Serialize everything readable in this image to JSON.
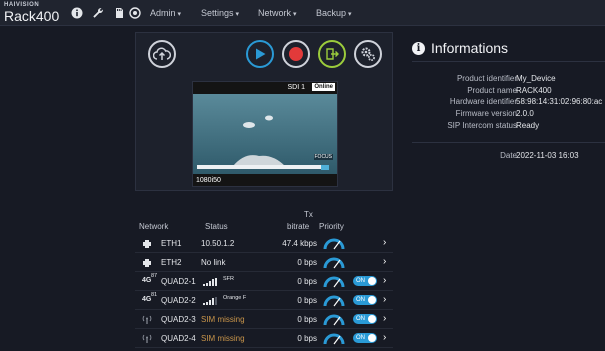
{
  "brand": {
    "company": "HAIVISION",
    "product": "Rack400"
  },
  "topbar": {
    "icons": [
      "info-icon",
      "wrench-icon",
      "sd-card-icon",
      "settings-circle-icon"
    ],
    "menus": [
      "Admin",
      "Settings",
      "Network",
      "Backup"
    ]
  },
  "controls": [
    "cloud-upload-icon",
    "play-icon",
    "record-icon",
    "export-icon",
    "gears-icon"
  ],
  "preview": {
    "input": "SDI 1",
    "status": "Online",
    "timecode": "1080i50",
    "watermark": "FOCUS"
  },
  "info": {
    "title": "Informations",
    "rows": [
      {
        "key": "Product identifier",
        "value": "My_Device"
      },
      {
        "key": "Product name",
        "value": "RACK400"
      },
      {
        "key": "Hardware identifier",
        "value": "58:98:14:31:02:96:80:ac"
      },
      {
        "key": "Firmware version",
        "value": "2.0.0"
      },
      {
        "key": "SIP Intercom status",
        "value": "Ready"
      }
    ],
    "date": {
      "key": "Date",
      "value": "2022-11-03 16:03"
    }
  },
  "network": {
    "headers": {
      "network": "Network",
      "status": "Status",
      "tx1": "Tx",
      "tx2": "bitrate",
      "priority": "Priority"
    },
    "rows": [
      {
        "name": "ETH1",
        "status": "10.50.1.2",
        "bitrate": "47.4 kbps",
        "type": "ethernet",
        "toggle": ""
      },
      {
        "name": "ETH2",
        "status": "No link",
        "bitrate": "0 bps",
        "type": "ethernet",
        "toggle": ""
      },
      {
        "name": "QUAD2-1",
        "status": "",
        "carrier": "SFR",
        "signal": "87",
        "bitrate": "0 bps",
        "type": "4g",
        "toggle": "ON"
      },
      {
        "name": "QUAD2-2",
        "status": "",
        "carrier": "Orange F",
        "signal": "81",
        "bitrate": "0 bps",
        "type": "4g",
        "toggle": "ON"
      },
      {
        "name": "QUAD2-3",
        "status": "SIM missing",
        "bitrate": "0 bps",
        "type": "antenna",
        "toggle": "ON"
      },
      {
        "name": "QUAD2-4",
        "status": "SIM missing",
        "bitrate": "0 bps",
        "type": "antenna",
        "toggle": "ON"
      }
    ]
  },
  "colors": {
    "background": "#171a24",
    "accent": "#2a9ad6",
    "warning": "#c9954a",
    "record": "#e23a3a",
    "export": "#9ccc3c"
  }
}
